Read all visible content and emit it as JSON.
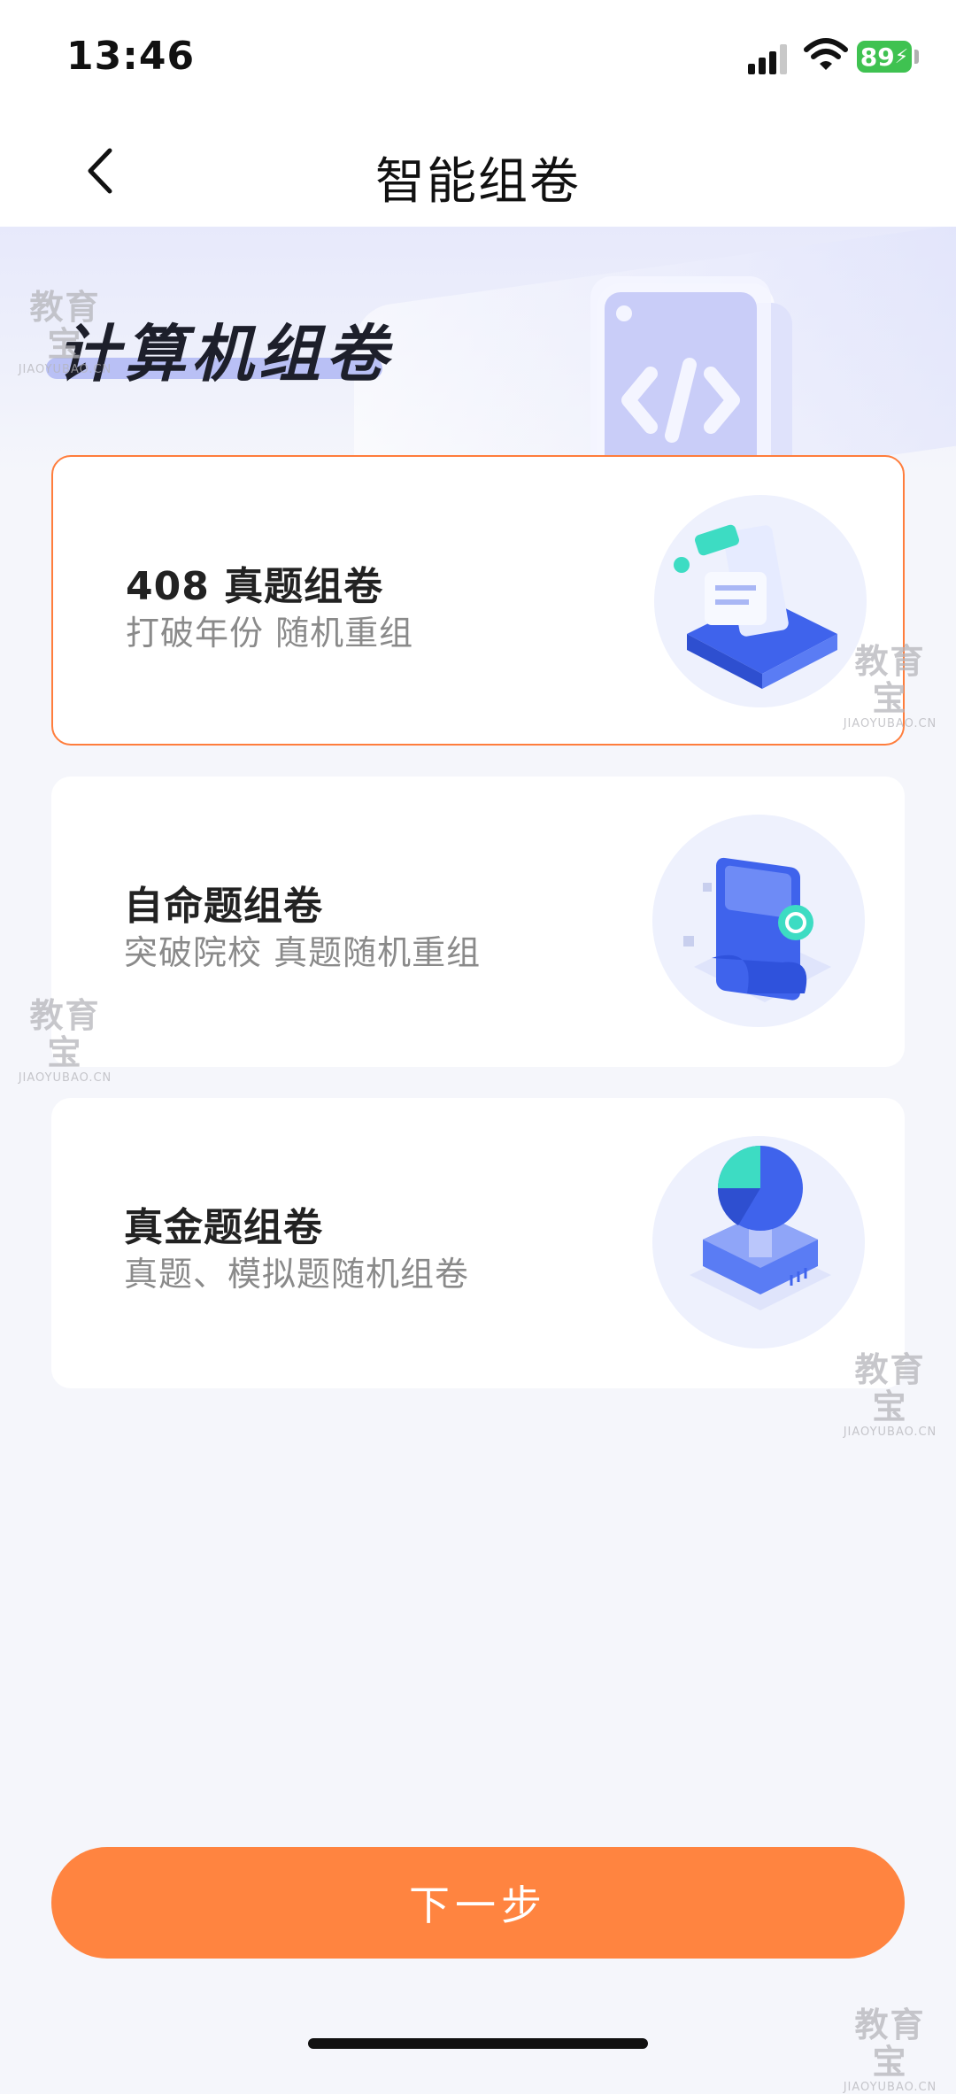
{
  "status_bar": {
    "time": "13:46",
    "battery": "89"
  },
  "nav": {
    "title": "智能组卷"
  },
  "hero": {
    "title": "计算机组卷"
  },
  "cards": [
    {
      "title": "408 真题组卷",
      "subtitle": "打破年份 随机重组",
      "selected": true
    },
    {
      "title": "自命题组卷",
      "subtitle": "突破院校 真题随机重组",
      "selected": false
    },
    {
      "title": "真金题组卷",
      "subtitle": "真题、模拟题随机组卷",
      "selected": false
    }
  ],
  "watermark": {
    "text": "教育宝",
    "sub": "JIAOYUBAO.CN"
  },
  "next_button": {
    "label": "下一步"
  },
  "colors": {
    "accent": "#ff8440",
    "battery": "#3fc251",
    "illustration_blue": "#4d6df5",
    "illustration_teal": "#3ddcc3"
  }
}
